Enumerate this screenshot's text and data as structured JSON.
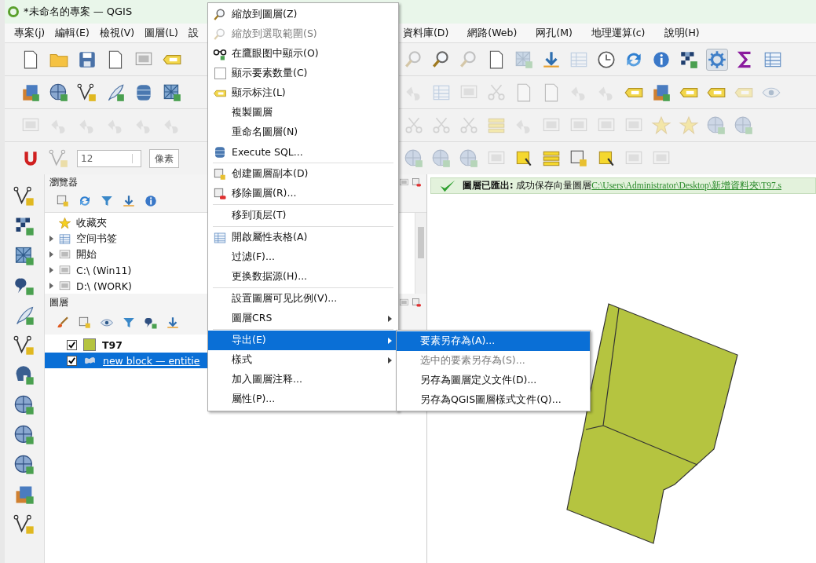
{
  "window": {
    "title": "*未命名的專案 — QGIS"
  },
  "menu_bar": {
    "left": [
      "專案(j)",
      "編輯(E)",
      "檢視(V)",
      "圖層(L)",
      "設"
    ],
    "right": [
      "資料庫(D)",
      "網路(Web)",
      "网孔(M)",
      "地理運算(c)",
      "說明(H)"
    ]
  },
  "snapping": {
    "tolerance": "12",
    "unit": "像素"
  },
  "browser_panel": {
    "title": "瀏覽器",
    "items": [
      {
        "label": "收藏夾",
        "expandable": false
      },
      {
        "label": "空间书签",
        "expandable": true
      },
      {
        "label": "開始",
        "expandable": true
      },
      {
        "label": "C:\\ (Win11)",
        "expandable": true
      },
      {
        "label": "D:\\ (WORK)",
        "expandable": true
      }
    ]
  },
  "layers_panel": {
    "title": "圖層",
    "layers": [
      {
        "name": "T97",
        "kind": "fill",
        "color": "#b5c440",
        "checked": true,
        "selected": false
      },
      {
        "name": "new block — entitie",
        "kind": "block",
        "checked": true,
        "selected": true
      }
    ]
  },
  "message_bar": {
    "title": "圖層已匯出:",
    "text": "成功保存向量圖層",
    "link": "C:\\Users\\Administrator\\Desktop\\新增資料夾\\T97.s"
  },
  "context_menu": {
    "groups": [
      [
        {
          "label": "縮放到圖層(Z)",
          "kind": "plain",
          "disabled": false,
          "submenu": false,
          "selected": false
        },
        {
          "label": "縮放到選取範圍(S)",
          "kind": "plain",
          "disabled": true,
          "submenu": false,
          "selected": false
        },
        {
          "label": "在鷹眼图中顯示(O)",
          "kind": "plain",
          "disabled": false,
          "submenu": false,
          "selected": false
        },
        {
          "label": "顯示要素数量(C)",
          "kind": "checkbox",
          "checked": false,
          "disabled": false,
          "submenu": false,
          "selected": false
        },
        {
          "label": "顯示标注(L)",
          "kind": "plain",
          "disabled": false,
          "submenu": false,
          "selected": false
        },
        {
          "label": "複製圖層",
          "kind": "plain",
          "disabled": false,
          "submenu": false,
          "selected": false
        },
        {
          "label": "重命名圖層(N)",
          "kind": "plain",
          "disabled": false,
          "submenu": false,
          "selected": false
        },
        {
          "label": "Execute SQL...",
          "kind": "plain",
          "disabled": false,
          "submenu": false,
          "selected": false
        }
      ],
      [
        {
          "label": "创建圖層副本(D)",
          "kind": "plain",
          "disabled": false,
          "submenu": false,
          "selected": false
        },
        {
          "label": "移除圖層(R)...",
          "kind": "plain",
          "disabled": false,
          "submenu": false,
          "selected": false
        }
      ],
      [
        {
          "label": "移到顶层(T)",
          "kind": "plain",
          "disabled": false,
          "submenu": false,
          "selected": false
        }
      ],
      [
        {
          "label": "開啟屬性表格(A)",
          "kind": "plain",
          "disabled": false,
          "submenu": false,
          "selected": false
        },
        {
          "label": "过滤(F)...",
          "kind": "plain",
          "disabled": false,
          "submenu": false,
          "selected": false
        },
        {
          "label": "更换数据源(H)...",
          "kind": "plain",
          "disabled": false,
          "submenu": false,
          "selected": false
        }
      ],
      [
        {
          "label": "設置圖層可见比例(V)...",
          "kind": "plain",
          "disabled": false,
          "submenu": false,
          "selected": false
        },
        {
          "label": "圖層CRS",
          "kind": "plain",
          "disabled": false,
          "submenu": true,
          "selected": false
        }
      ],
      [
        {
          "label": "导出(E)",
          "kind": "plain",
          "disabled": false,
          "submenu": true,
          "selected": true
        },
        {
          "label": "樣式",
          "kind": "plain",
          "disabled": false,
          "submenu": true,
          "selected": false
        },
        {
          "label": "加入圖層注释...",
          "kind": "plain",
          "disabled": false,
          "submenu": false,
          "selected": false
        },
        {
          "label": "屬性(P)...",
          "kind": "plain",
          "disabled": false,
          "submenu": false,
          "selected": false
        }
      ]
    ]
  },
  "submenu": {
    "items": [
      {
        "label": "要素另存為(A)...",
        "disabled": false,
        "selected": true
      },
      {
        "label": "选中的要素另存為(S)...",
        "disabled": true,
        "selected": false
      },
      {
        "label": "另存為圖層定义文件(D)...",
        "disabled": false,
        "selected": false
      },
      {
        "label": "另存為QGIS圖層樣式文件(Q)...",
        "disabled": false,
        "selected": false
      }
    ]
  }
}
